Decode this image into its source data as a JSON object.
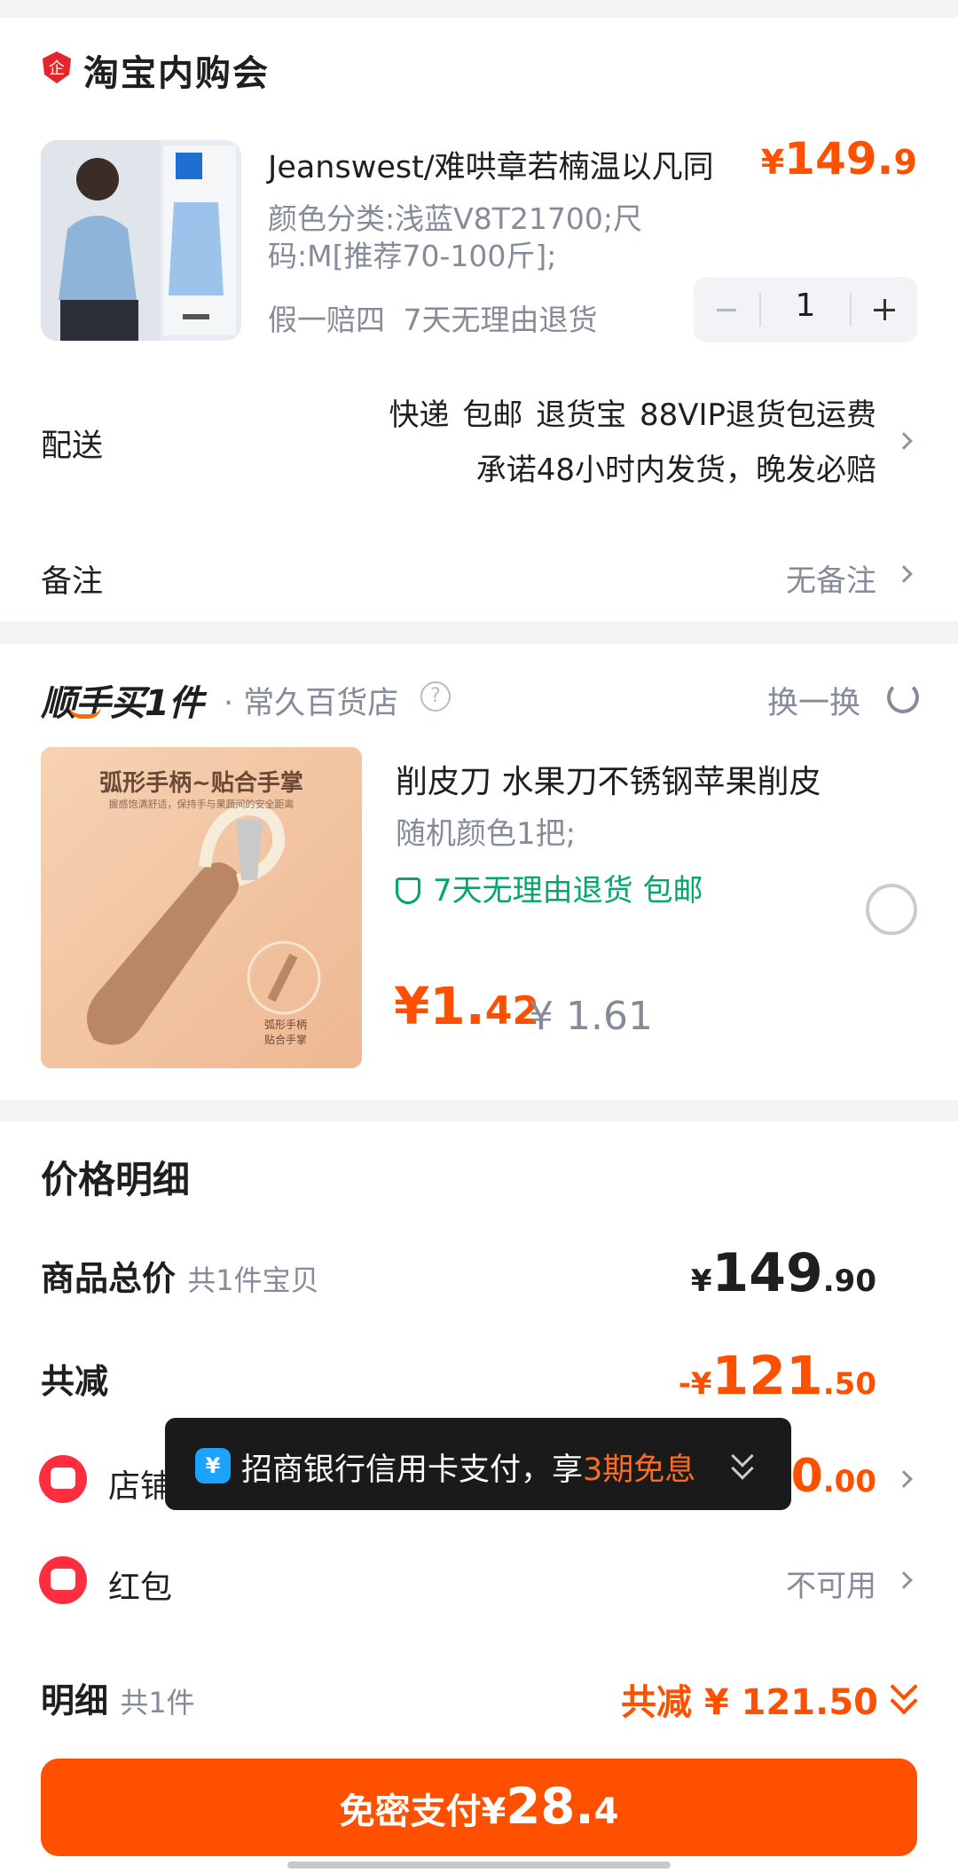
{
  "order": {
    "shop_name": "淘宝内购会",
    "product": {
      "title": "Jeanswest/难哄章若楠温以凡同",
      "price_symbol": "¥",
      "price_int": "149.",
      "price_dec": "9",
      "sku": "颜色分类:浅蓝V8T21700;尺码:M[推荐70-100斤];",
      "promise": "假一赔四 7天无理由退货",
      "quantity": "1"
    },
    "delivery": {
      "label": "配送",
      "line1": "快递 包邮 退货宝 88VIP退货包运费",
      "line2": "承诺48小时内发货，晚发必赔"
    },
    "remark": {
      "label": "备注",
      "value": "无备注"
    }
  },
  "addon": {
    "brand": "顺手买1件",
    "store": "· 常久百货店",
    "help_icon": "?",
    "swap_label": "换一换",
    "image_caption": "弧形手柄~贴合手掌",
    "image_sub": "握感饱满舒适，保持手与果蔬间的安全距离",
    "image_badge": "弧形手柄 贴合手掌",
    "title": "削皮刀 水果刀不锈钢苹果削皮",
    "sku": "随机颜色1把;",
    "tags": "7天无理由退货  包邮",
    "price_symbol": "¥",
    "price_int": "1.",
    "price_dec": "42",
    "orig_price": "¥ 1.61"
  },
  "price_detail": {
    "title": "价格明细",
    "total": {
      "label": "商品总价",
      "sub": "共1件宝贝",
      "symbol": "¥",
      "int": "149",
      "dec": ".90"
    },
    "discount": {
      "label": "共减",
      "symbol": "-¥",
      "int": "121",
      "dec": ".50"
    },
    "store_promo": {
      "label": "店铺",
      "int": "20",
      "dec": ".00"
    },
    "red_packet": {
      "label": "红包",
      "value": "不可用"
    },
    "detail": {
      "label": "明细",
      "sub": "共1件",
      "value": "共减 ¥ 121.50"
    }
  },
  "pay_button": {
    "prefix": "免密支付¥",
    "int": "28.",
    "dec": "4"
  },
  "tooltip": {
    "icon": "¥",
    "text_a": "招商银行信用卡支付，享",
    "text_b": "3期免息"
  },
  "colors": {
    "accent": "#ff5000",
    "green": "#00a86b",
    "red_icon": "#ff2e3f",
    "tooltip_bg": "#1a1a1a"
  }
}
